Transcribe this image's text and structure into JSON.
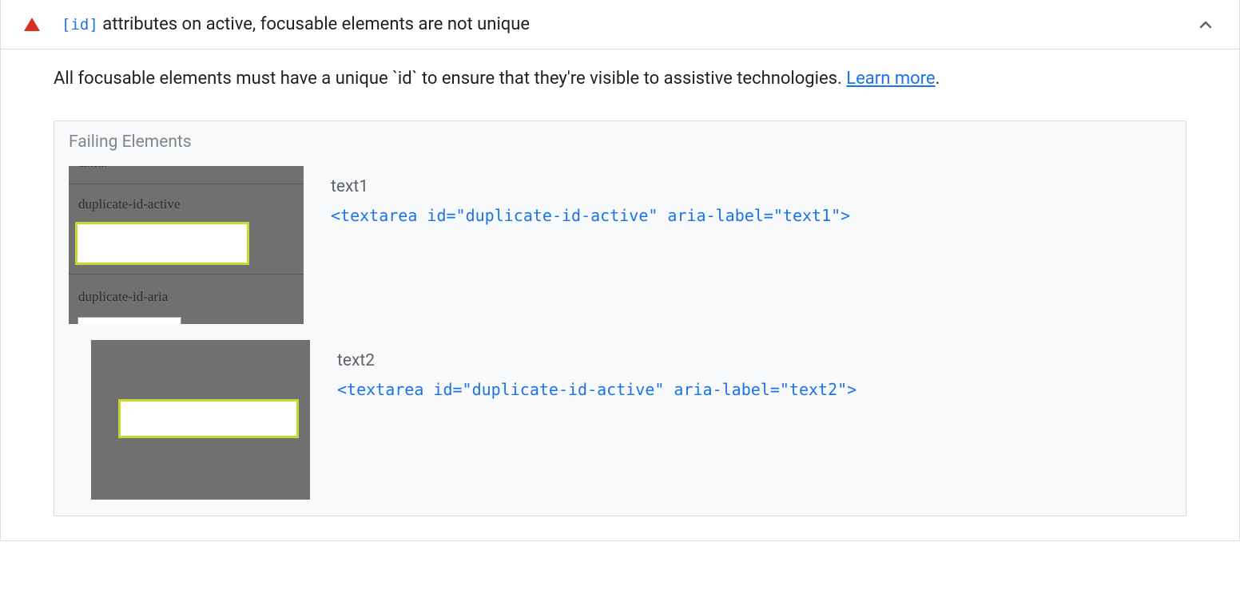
{
  "header": {
    "code_tag": "[id]",
    "title_rest": " attributes on active, focusable elements are not unique"
  },
  "description": {
    "text": "All focusable elements must have a unique `id` to ensure that they're visible to assistive technologies. ",
    "learn_more": "Learn more"
  },
  "failing": {
    "heading": "Failing Elements",
    "items": [
      {
        "label": "text1",
        "code": "<textarea id=\"duplicate-id-active\" aria-label=\"text1\">",
        "thumb_labels": {
          "top": "dlitem",
          "mid": "duplicate-id-active",
          "bottom": "duplicate-id-aria"
        }
      },
      {
        "label": "text2",
        "code": "<textarea id=\"duplicate-id-active\" aria-label=\"text2\">"
      }
    ]
  }
}
